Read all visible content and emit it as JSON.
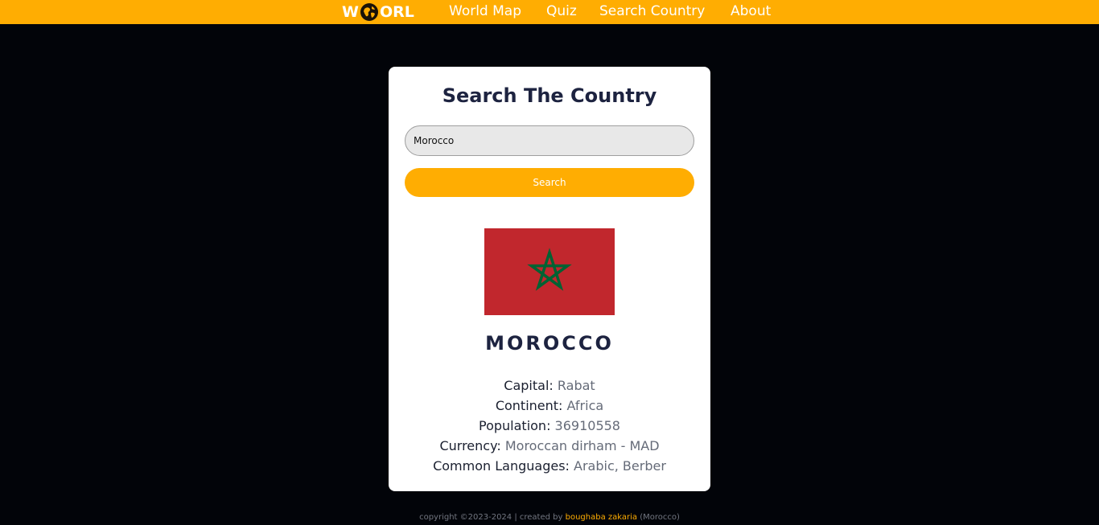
{
  "nav": {
    "logo_left": "W",
    "logo_right": "ORL",
    "links": [
      "World Map",
      "Quiz",
      "Search Country",
      "About"
    ]
  },
  "card": {
    "title": "Search The Country",
    "search_value": "Morocco",
    "search_button": "Search"
  },
  "country": {
    "name": "MOROCCO",
    "flag_icon": "morocco-flag",
    "details": [
      {
        "label": "Capital:",
        "value": "Rabat"
      },
      {
        "label": "Continent:",
        "value": "Africa"
      },
      {
        "label": "Population:",
        "value": "36910558"
      },
      {
        "label": "Currency:",
        "value": "Moroccan dirham - MAD"
      },
      {
        "label": "Common Languages:",
        "value": "Arabic, Berber"
      }
    ]
  },
  "footer": {
    "prefix": "copyright ©2023-2024 | created by ",
    "author": "boughaba zakaria",
    "suffix": " (Morocco)"
  },
  "colors": {
    "accent": "#ffad02",
    "background": "#020409",
    "heading": "#1d2340",
    "flag_red": "#c1272d",
    "flag_green": "#006233"
  }
}
